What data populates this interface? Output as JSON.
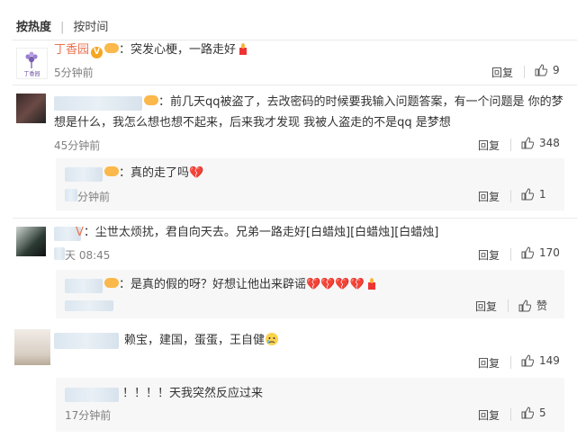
{
  "sort": {
    "active": "按热度",
    "other": "按时间"
  },
  "comments": [
    {
      "user": "丁香园",
      "sep": "：",
      "text": "突发心梗，一路走好",
      "time": "5分钟前",
      "reply": "回复",
      "likes": "9",
      "avatar_text": "丁香园"
    },
    {
      "user": "",
      "sep": "：",
      "text1": "前几天qq被盗了，去改密码的时候要我输入问题答案，有一个问题是 你的梦",
      "text2": "想是什么，我怎么想也想不起来，后来我才发现 我被人盗走的不是qq 是梦想",
      "time": "45分钟前",
      "reply": "回复",
      "likes": "348"
    },
    {
      "user": "",
      "sep": "：",
      "text": "真的走了吗",
      "time": "分钟前",
      "reply": "回复",
      "likes": "1"
    },
    {
      "user": "V",
      "sep": "：",
      "text": "尘世太烦扰，君自向天去。兄弟一路走好[白蜡烛][白蜡烛][白蜡烛]",
      "time": "天 08:45",
      "reply": "回复",
      "likes": "170"
    },
    {
      "user": "",
      "sep": "：",
      "text": "是真的假的呀？好想让他出来辟谣",
      "time": "",
      "reply": "回复",
      "likes": "赞"
    },
    {
      "user": "",
      "sep": "",
      "text": "赖宝，建国，蛋蛋，王自健",
      "time": "",
      "reply": "回复",
      "likes": "149"
    },
    {
      "user": "",
      "sep": "",
      "text": "！！！！天我突然反应过来",
      "time": "17分钟前",
      "reply": "回复",
      "likes": "5"
    }
  ],
  "colors": {
    "username": "#eb7350",
    "meta": "#808080",
    "text": "#333333",
    "badge": "#f5a623"
  }
}
